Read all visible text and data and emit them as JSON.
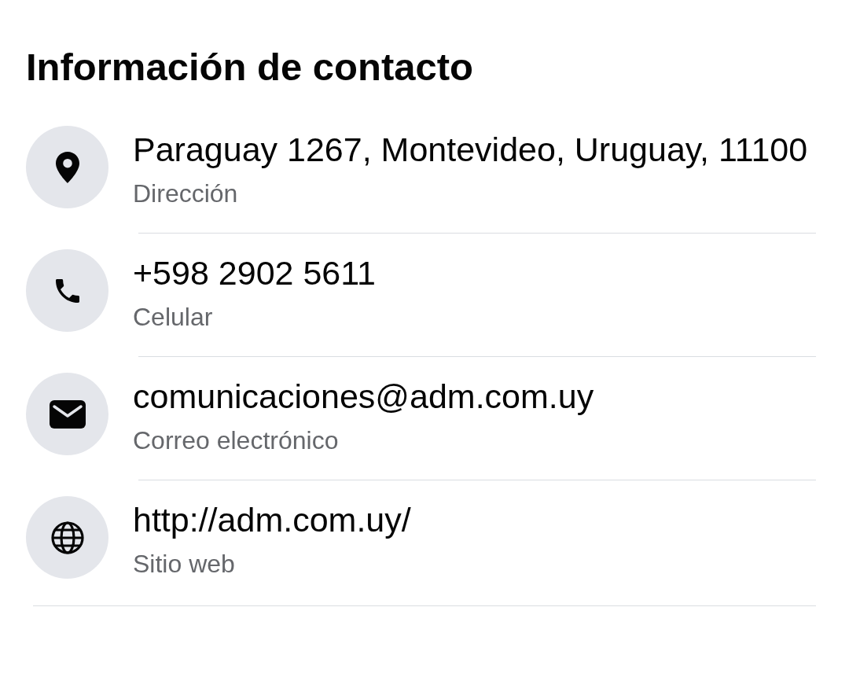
{
  "title": "Información de contacto",
  "items": [
    {
      "kind": "address",
      "value": "Paraguay 1267, Montevideo, Uruguay, 11100",
      "label": "Dirección"
    },
    {
      "kind": "phone",
      "value": "+598 2902 5611",
      "label": "Celular"
    },
    {
      "kind": "email",
      "value": "comunicaciones@adm.com.uy",
      "label": "Correo electrónico"
    },
    {
      "kind": "website",
      "value": "http://adm.com.uy/",
      "label": "Sitio web"
    }
  ]
}
